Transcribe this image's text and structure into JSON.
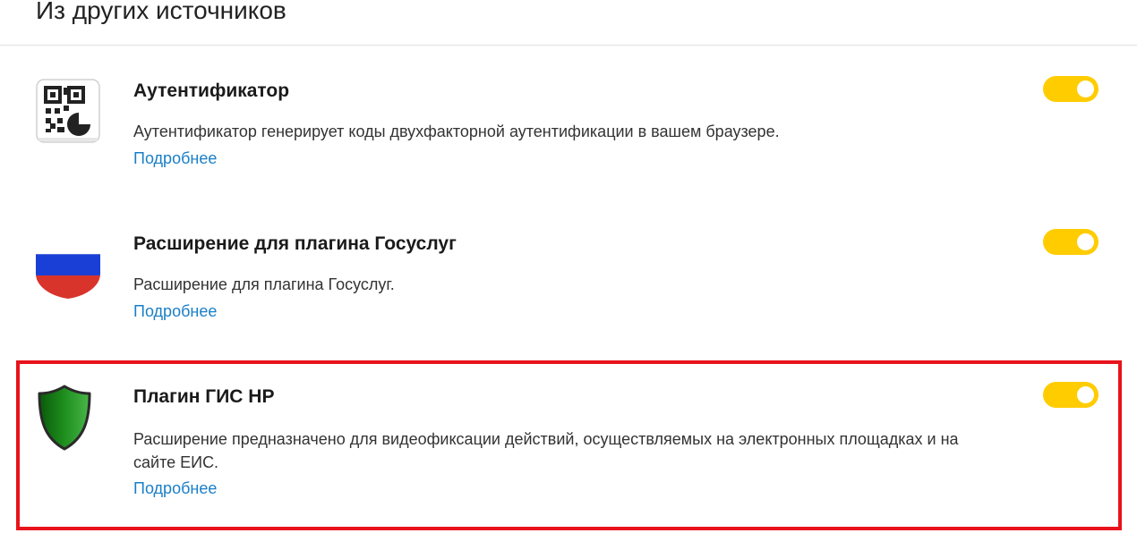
{
  "section": {
    "title": "Из других источников"
  },
  "extensions": [
    {
      "icon": "qr-code-icon",
      "name": "Аутентификатор",
      "description": "Аутентификатор генерирует коды двухфакторной аутентификации в вашем браузере.",
      "more_label": "Подробнее",
      "enabled": true
    },
    {
      "icon": "russian-flag-shield-icon",
      "name": "Расширение для плагина Госуслуг",
      "description": "Расширение для плагина Госуслуг.",
      "more_label": "Подробнее",
      "enabled": true
    },
    {
      "icon": "green-shield-icon",
      "name": "Плагин ГИС НР",
      "description": "Расширение предназначено для видеофиксации действий, осуществляемых на электронных площадках и на сайте ЕИС.",
      "more_label": "Подробнее",
      "enabled": true
    }
  ],
  "colors": {
    "toggle_on": "#ffcc00",
    "link": "#1a7fc7",
    "highlight": "#e8131b"
  }
}
